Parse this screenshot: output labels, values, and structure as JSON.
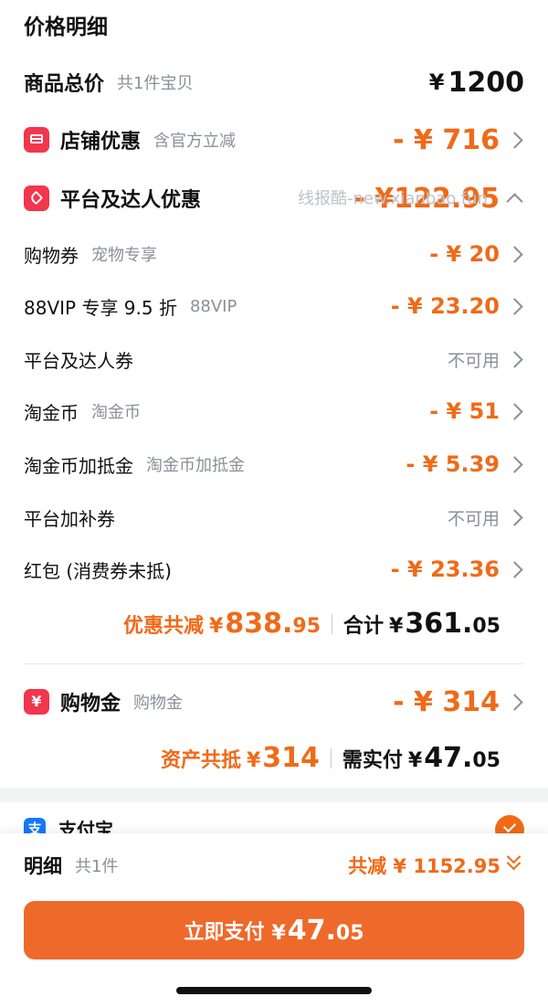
{
  "title": "价格明细",
  "goods_total": {
    "label": "商品总价",
    "sub": "共1件宝贝",
    "yen": "¥",
    "value": "1200"
  },
  "store_discount": {
    "label": "店铺优惠",
    "sub": "含官方立减",
    "amount": "- ¥ 716"
  },
  "platform_discount": {
    "label": "平台及达人优惠",
    "amount": "- ¥122.95"
  },
  "watermark": "线报酷-new.xianbao.fun",
  "items": [
    {
      "label": "购物券",
      "sub": "宠物专享",
      "amount": "- ¥ 20"
    },
    {
      "label": "88VIP 专享 9.5 折",
      "sub": "88VIP",
      "amount": "- ¥ 23.20"
    },
    {
      "label": "平台及达人券",
      "sub": "",
      "status": "不可用"
    },
    {
      "label": "淘金币",
      "sub": "淘金币",
      "amount": "- ¥ 51"
    },
    {
      "label": "淘金币加抵金",
      "sub": "淘金币加抵金",
      "amount": "- ¥ 5.39"
    },
    {
      "label": "平台加补券",
      "sub": "",
      "status": "不可用"
    },
    {
      "label": "红包 (消费券未抵)",
      "sub": "",
      "amount": "- ¥ 23.36"
    }
  ],
  "discount_summary": {
    "label": "优惠共减",
    "yen": "¥",
    "int": "838.",
    "dec": "95",
    "total_label": "合计",
    "total_int": "361.",
    "total_dec": "05"
  },
  "shopping_gold": {
    "label": "购物金",
    "sub": "购物金",
    "icon_char": "¥",
    "amount": "- ¥ 314"
  },
  "asset_summary": {
    "label": "资产共抵",
    "yen": "¥",
    "value": "314",
    "pay_label": "需实付",
    "pay_int": "47.",
    "pay_dec": "05"
  },
  "payment": {
    "method": "支付宝",
    "icon_char": "支"
  },
  "footer": {
    "detail_label": "明细",
    "detail_sub": "共1件",
    "saved": "共减 ¥ 1152.95",
    "pay_label": "立即支付",
    "pay_yen": "¥",
    "pay_int": "47.",
    "pay_dec": "05"
  },
  "colors": {
    "accent": "#f06a18",
    "button": "#ed6a2a",
    "icon_red": "#f1364d",
    "alipay_blue": "#1677ff",
    "muted": "#8a8f99"
  }
}
